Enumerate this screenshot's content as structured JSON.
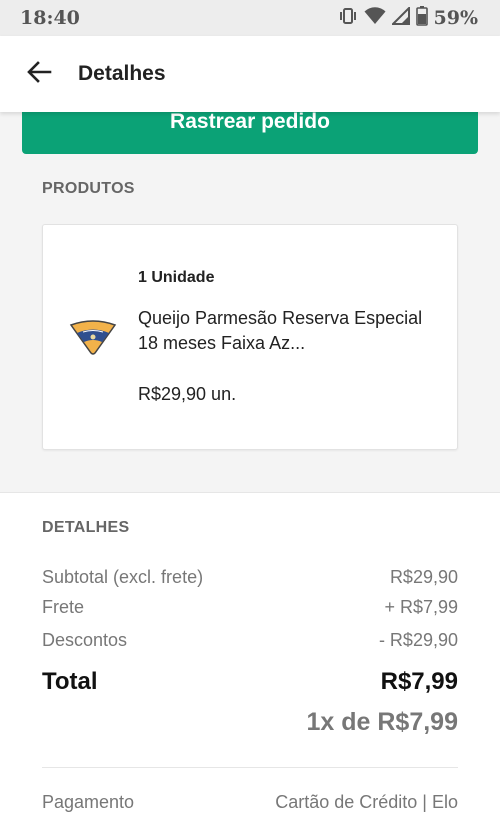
{
  "status_bar": {
    "time": "18:40",
    "battery_percent": "59%",
    "icons": [
      "vibrate-icon",
      "wifi-icon",
      "signal-icon",
      "battery-icon"
    ]
  },
  "header": {
    "title": "Detalhes",
    "back_icon": "arrow-left-icon"
  },
  "actions": {
    "track_order_label": "Rastrear pedido",
    "accent_color": "#0ba276"
  },
  "products": {
    "section_title": "PRODUTOS",
    "items": [
      {
        "quantity": "1 Unidade",
        "name": "Queijo Parmesão Reserva Especial 18 meses Faixa Az...",
        "unit_price": "R$29,90 un."
      }
    ]
  },
  "details": {
    "section_title": "DETALHES",
    "subtotal_label": "Subtotal (excl. frete)",
    "subtotal_value": "R$29,90",
    "shipping_label": "Frete",
    "shipping_value": "+ R$7,99",
    "discounts_label": "Descontos",
    "discounts_value": "- R$29,90",
    "total_label": "Total",
    "total_value": "R$7,99",
    "installments": "1x de R$7,99",
    "payment_label": "Pagamento",
    "payment_value": "Cartão de Crédito | Elo"
  }
}
